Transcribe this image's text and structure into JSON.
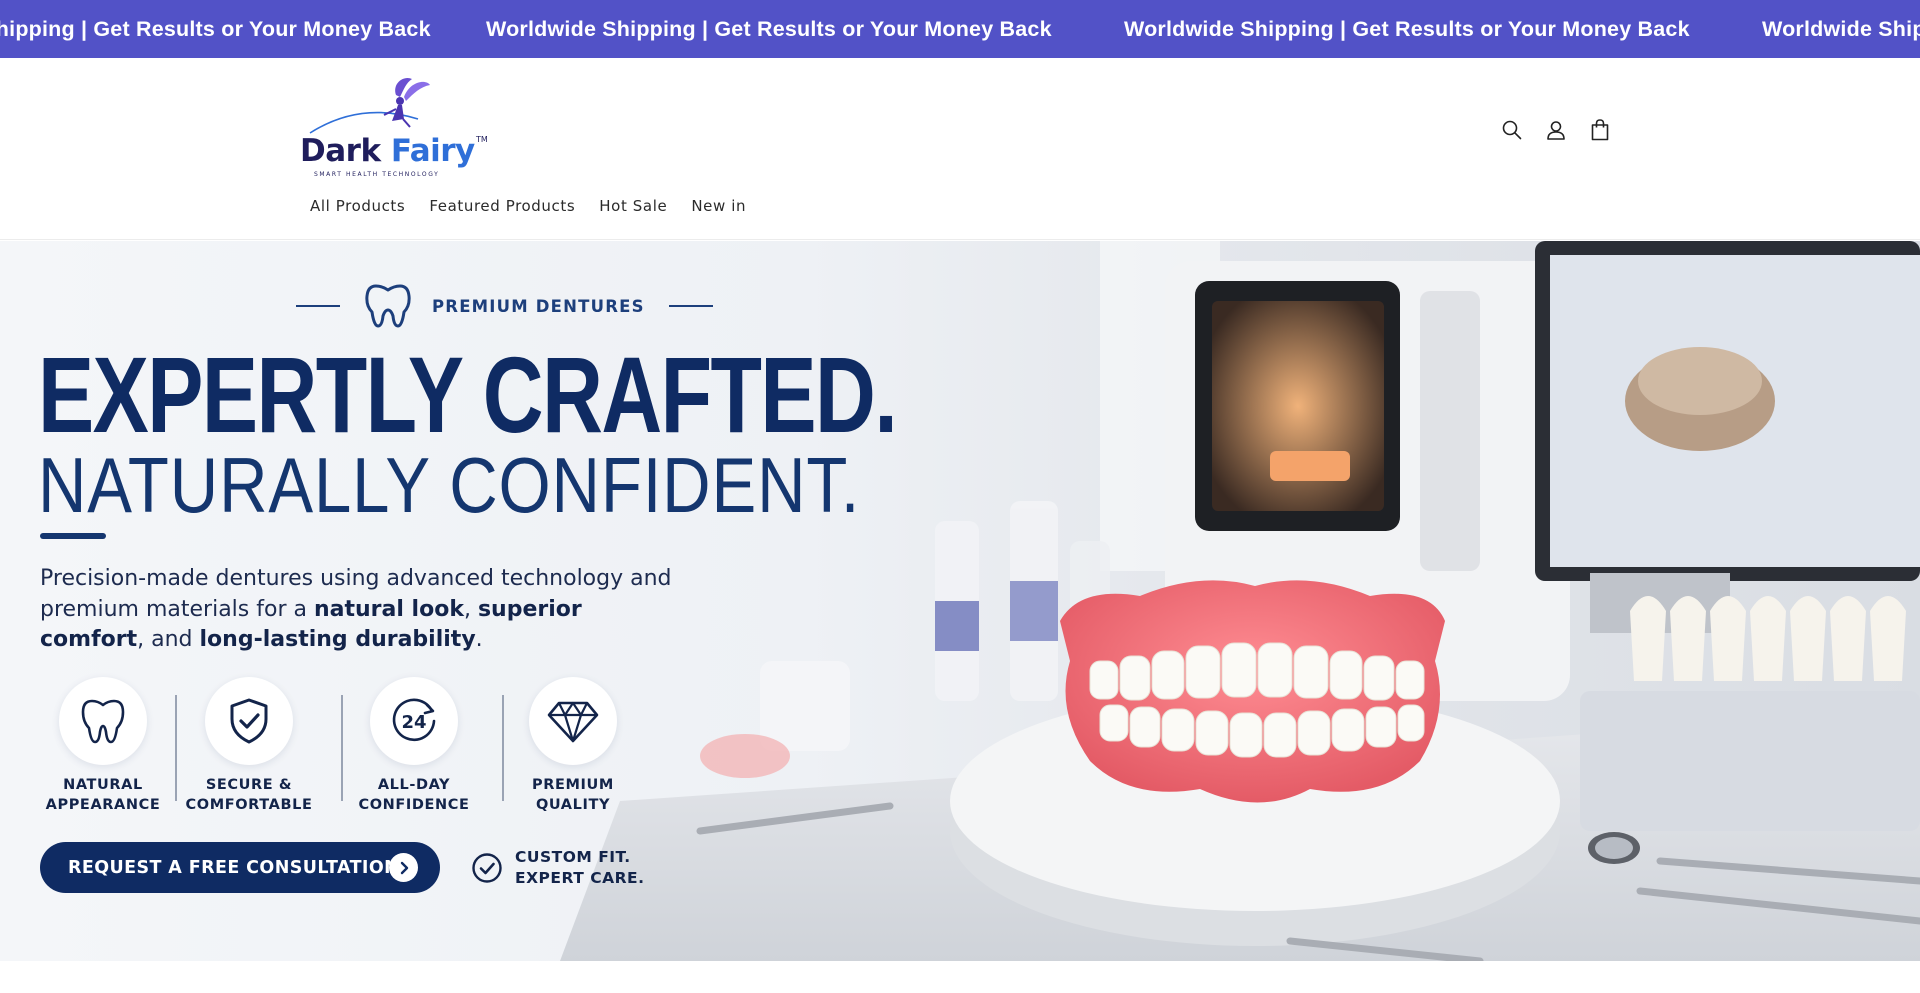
{
  "announcement": {
    "items": [
      "Worldwide Shipping | Get Results or Your Money Back",
      "Worldwide Shipping | Get Results or Your Money Back",
      "Worldwide Shipping | Get Results or Your Money Back",
      "Worldwide Shipping | Get Results or Your Money Back"
    ],
    "background": "#5252c7",
    "text_color": "#ffffff"
  },
  "header": {
    "logo": {
      "name_part1": "Dark ",
      "name_part2": "Fairy",
      "trademark": "TM",
      "tagline": "SMART HEALTH TECHNOLOGY",
      "colors": {
        "primary": "#1f1d5c",
        "secondary": "#2f6fd8",
        "fairy": "#6a4fd1"
      }
    },
    "nav": [
      {
        "label": "All Products"
      },
      {
        "label": "Featured Products"
      },
      {
        "label": "Hot Sale"
      },
      {
        "label": "New in"
      }
    ],
    "icons": [
      "search-icon",
      "account-icon",
      "cart-icon"
    ]
  },
  "hero": {
    "eyebrow": "PREMIUM DENTURES",
    "headline": "EXPERTLY CRAFTED.",
    "subheadline": "NATURALLY CONFIDENT.",
    "description": {
      "part1": "Precision-made dentures using advanced technology and premium materials for a ",
      "bold1": "natural look",
      "sep1": ", ",
      "bold2": "superior comfort",
      "sep2": ", and ",
      "bold3": "long-lasting durability",
      "end": "."
    },
    "features": [
      {
        "icon": "tooth-icon",
        "line1": "NATURAL",
        "line2": "APPEARANCE"
      },
      {
        "icon": "shield-check-icon",
        "line1": "SECURE &",
        "line2": "COMFORTABLE"
      },
      {
        "icon": "clock-24-icon",
        "line1": "ALL-DAY",
        "line2": "CONFIDENCE",
        "badge": "24"
      },
      {
        "icon": "diamond-icon",
        "line1": "PREMIUM",
        "line2": "QUALITY"
      }
    ],
    "cta_label": "REQUEST A FREE CONSULTATION",
    "custom_fit": {
      "line1": "CUSTOM FIT.",
      "line2": "EXPERT CARE."
    },
    "colors": {
      "navy": "#0f2b63",
      "denture_gum": "#f06a72"
    }
  }
}
